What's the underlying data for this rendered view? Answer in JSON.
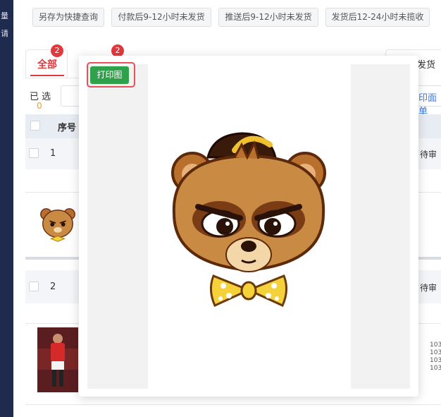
{
  "quick_filters": [
    "另存为快捷查询",
    "付款后9-12小时未发货",
    "推送后9-12小时未发货",
    "发货后12-24小时未揽收"
  ],
  "tabs": {
    "all_label": "全部",
    "all_badge": "2",
    "second_badge": "2",
    "right_label": "发货"
  },
  "selection": {
    "label": "已 选",
    "count": "0"
  },
  "toolbar": {
    "print_face_label": "印面单"
  },
  "table": {
    "header_seq": "序号",
    "rows": [
      {
        "seq": "1",
        "status": "待审",
        "thumb": "bear-sticker"
      },
      {
        "seq": "2",
        "status": "待审",
        "thumb": "football-player-photo",
        "order_numbers": [
          "103",
          "103",
          "103",
          "103"
        ]
      }
    ]
  },
  "modal": {
    "print_button_label": "打印图",
    "image": "bear-mascot-with-bowtie"
  },
  "sidebar": {
    "glyphs": [
      "量",
      "请"
    ]
  },
  "colors": {
    "accent_red": "#e0393e",
    "print_green": "#2ea24a",
    "highlight_ring": "#e8505b",
    "link_blue": "#3a78e7",
    "sidebar_navy": "#1f2a4f",
    "count_orange": "#f0a020"
  }
}
